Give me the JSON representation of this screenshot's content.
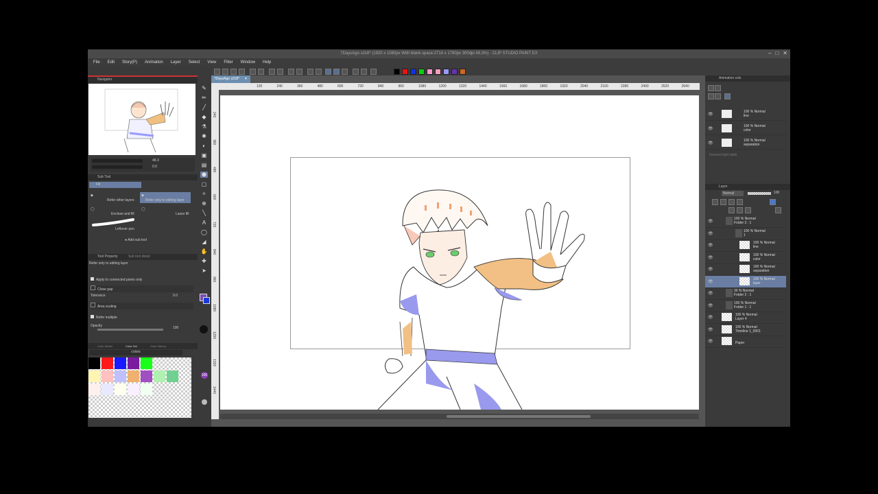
{
  "window": {
    "title": "7DaysAgo s2c8* (1920 x 1080px With blank space:2714 x 1780px 300dpi 48.3%) - CLIP STUDIO PAINT EX"
  },
  "menu": [
    "File",
    "Edit",
    "Story(P)",
    "Animation",
    "Layer",
    "Select",
    "View",
    "Filter",
    "Window",
    "Help"
  ],
  "palette_colors": [
    "#000000",
    "#ee1111",
    "#1133dd",
    "#11cc11",
    "#ff99cc",
    "#ff99bb",
    "#9999ff",
    "#6633aa",
    "#cc6622"
  ],
  "navigator": {
    "label": "Navigator",
    "zoom": "48.3",
    "rotation": "0.0"
  },
  "subtool": {
    "header": "Sub Tool",
    "group": "Fill",
    "items": [
      "Refer other layers",
      "Refer only to editing layer",
      "Enclose and fill",
      "Lasso fill",
      "Leftover pen"
    ],
    "add_label": "Add sub tool"
  },
  "tool_property": {
    "header": "Tool Property",
    "sub_header": "Sub tool detail",
    "title": "Refer only to editing layer",
    "apply_connected": "Apply to connected pixels only",
    "close_gap": "Close gap",
    "tolerance_label": "Tolerance",
    "tolerance_value": "0.0",
    "area_scaling": "Area scaling",
    "refer_multiple": "Refer multiple",
    "opacity_label": "Opacity",
    "opacity_value": "100"
  },
  "color_set": {
    "tabs": [
      "Color Wheel",
      "Color Set",
      "Color History"
    ],
    "name": "colors",
    "row1": [
      "#000000",
      "#ff1a1a",
      "#1a1aff",
      "#7a1a9e",
      "#1aff1a"
    ],
    "row2": [
      "#fff5b0",
      "#ffc0c0",
      "#c0c0ff",
      "#f0b070",
      "#a050c0",
      "#b0f0b0",
      "#70d090"
    ],
    "row3": [
      "#fff0f0",
      "#e8e8ff",
      "#fffff0",
      "#f8f0ff",
      "#f0fff0"
    ]
  },
  "document": {
    "tab": "7DaysAgo s2c8*",
    "ruler_top": [
      "120",
      "240",
      "360",
      "480",
      "600",
      "720",
      "840",
      "960",
      "1080",
      "1200",
      "1320",
      "1440",
      "1560",
      "1680",
      "1800",
      "1920",
      "2040",
      "2160",
      "2280",
      "2400",
      "2520",
      "2640"
    ],
    "ruler_left": [
      "240",
      "360",
      "480",
      "600",
      "720",
      "840",
      "960",
      "1080",
      "1200",
      "1320",
      "1440"
    ]
  },
  "animation_cels": {
    "header": "Animation cels",
    "rows": [
      {
        "mode": "100 % Normal",
        "name": "line"
      },
      {
        "mode": "100 % Normal",
        "name": "color"
      },
      {
        "mode": "100 % Normal",
        "name": "separation"
      }
    ],
    "footer": "General light table"
  },
  "layers": {
    "header": "Layer",
    "blend_mode": "Normal",
    "opacity": "100",
    "rows": [
      {
        "mode": "100 % Normal",
        "name": "Folder 3 : 1"
      },
      {
        "mode": "100 % Normal",
        "name": "1"
      },
      {
        "mode": "100 % Normal",
        "name": "line"
      },
      {
        "mode": "100 % Normal",
        "name": "color"
      },
      {
        "mode": "100 % Normal",
        "name": "separation"
      },
      {
        "mode": "100 % Normal",
        "name": "layer"
      },
      {
        "mode": "30 % Normal",
        "name": "Folder 2 : 1"
      },
      {
        "mode": "100 % Normal",
        "name": "Folder 1 : 1"
      },
      {
        "mode": "100 % Normal",
        "name": "Layer 4"
      },
      {
        "mode": "100 % Normal",
        "name": "Timeline 1_0001"
      },
      {
        "mode": "",
        "name": "Paper"
      }
    ]
  },
  "colors": {
    "selection": "#6a7ea3",
    "panel": "#3a3a3a",
    "accent_tab": "#6d8fb0"
  }
}
